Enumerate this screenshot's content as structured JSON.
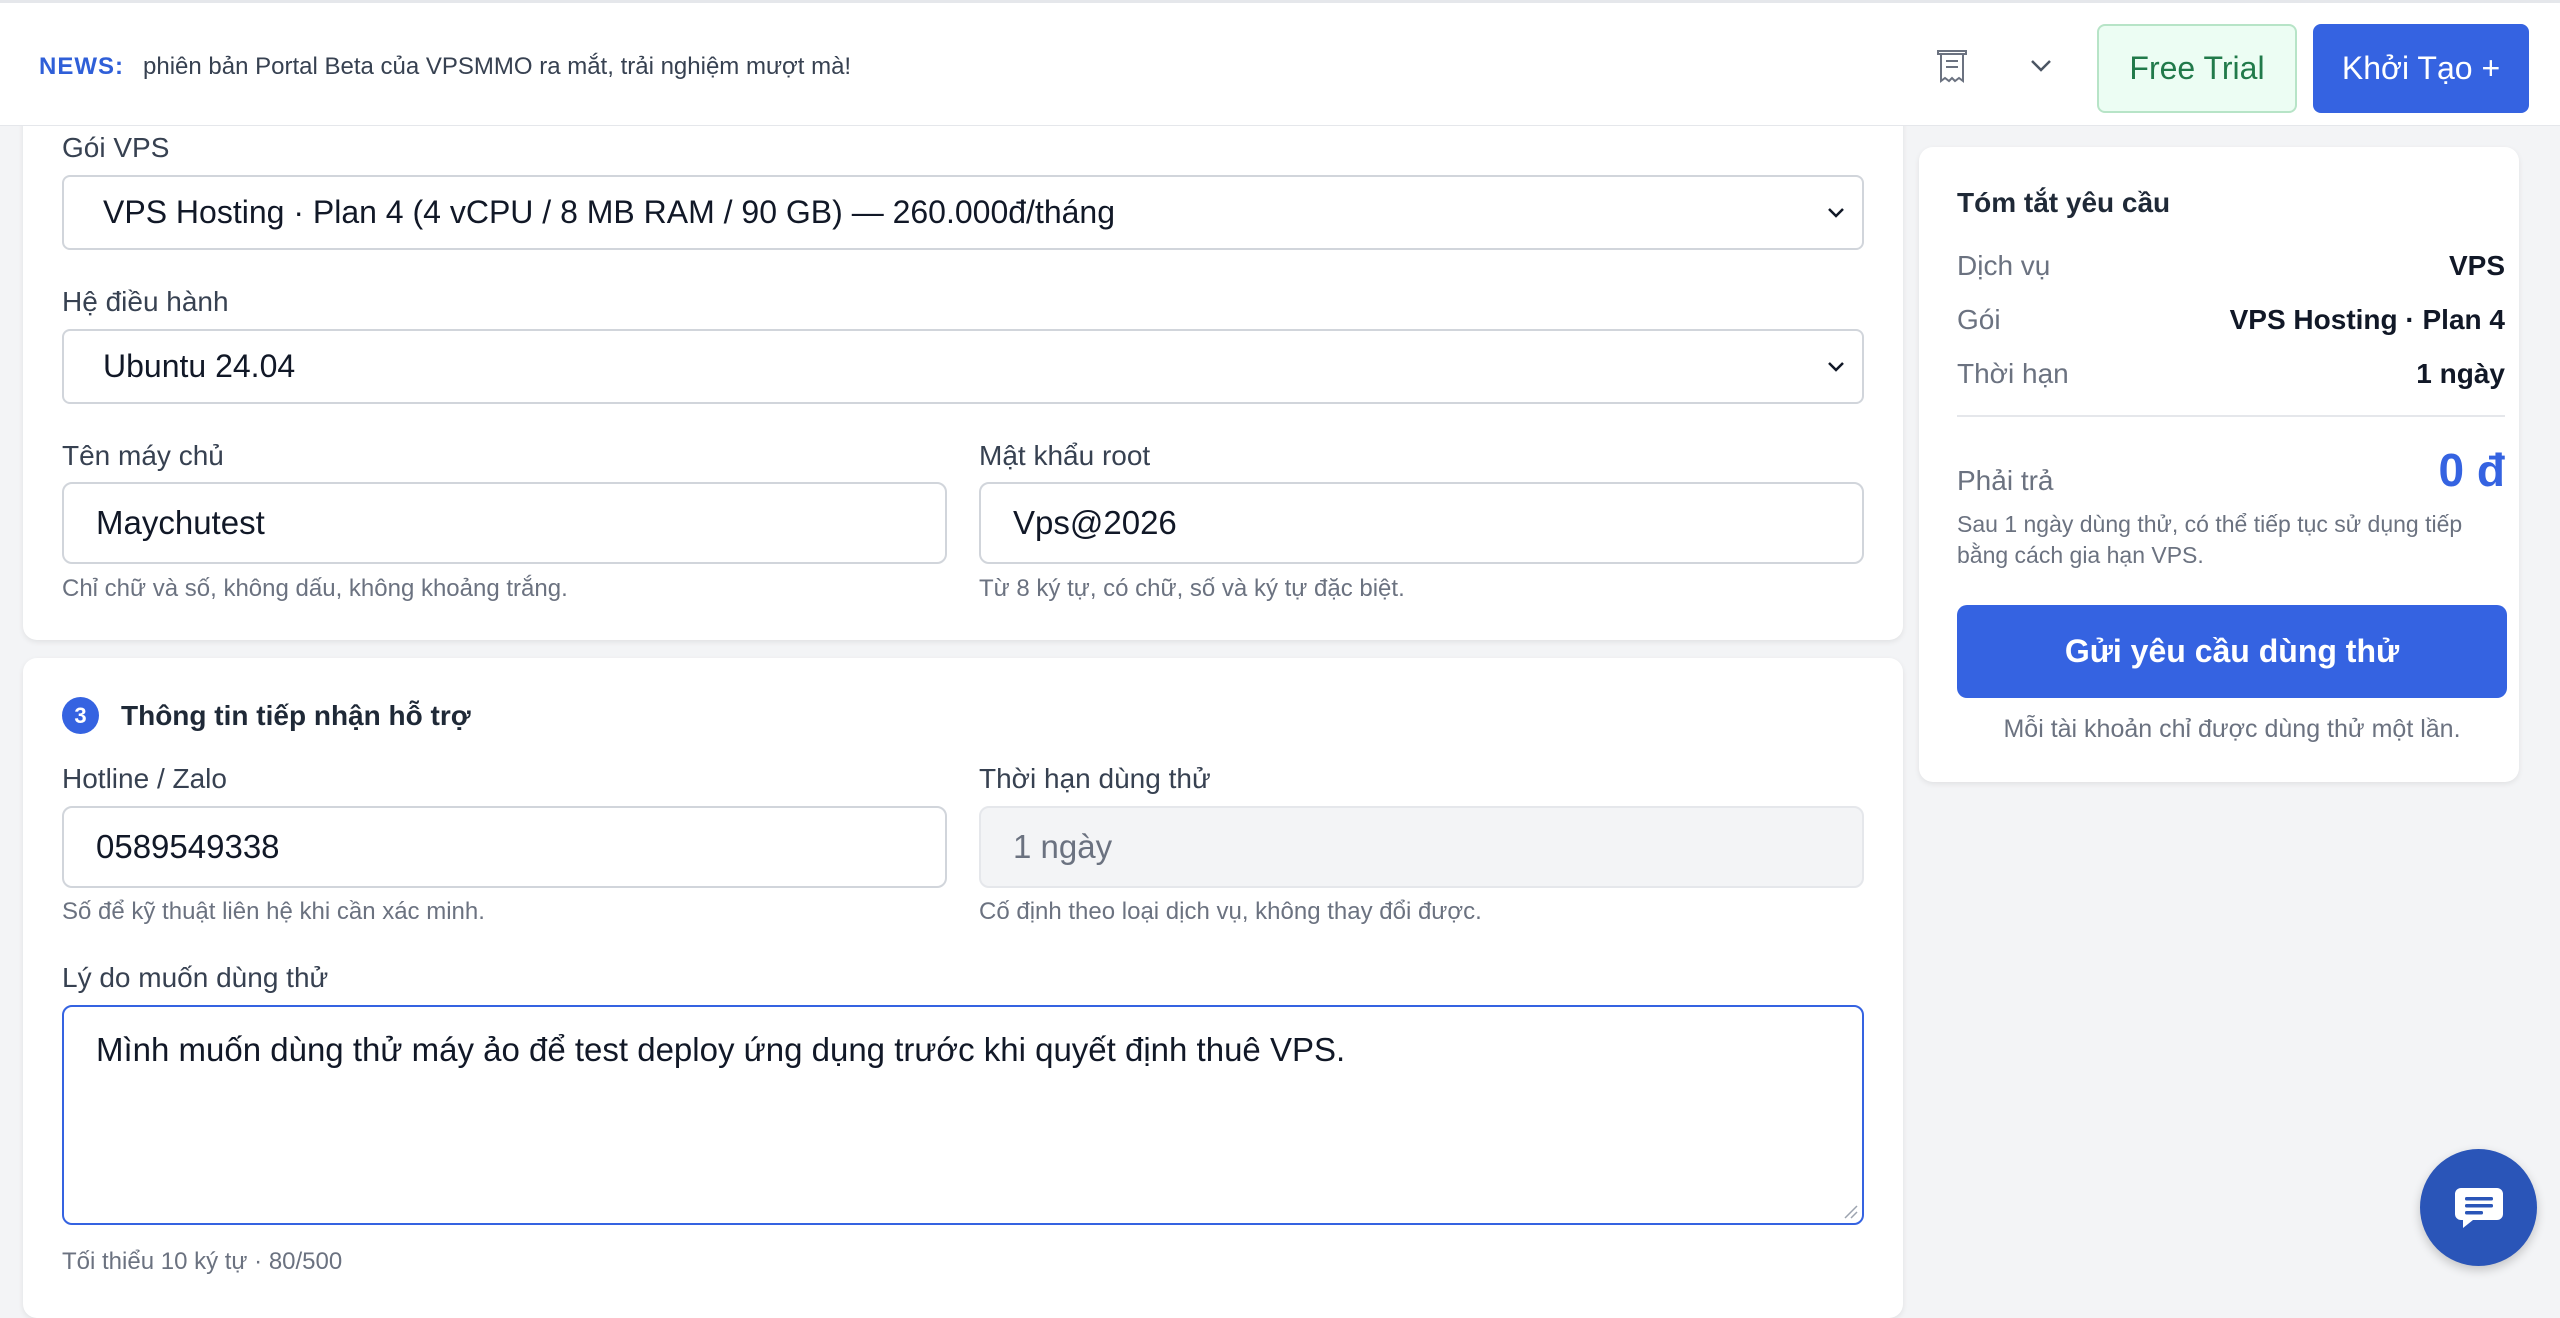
{
  "topbar": {
    "news_label": "NEWS:",
    "news_text": "phiên bản Portal Beta của VPSMMO ra mắt, trải nghiệm mượt mà!",
    "free_trial_label": "Free Trial",
    "create_label": "Khởi Tạo +"
  },
  "form": {
    "plan_label": "Gói VPS",
    "plan_value": "VPS Hosting · Plan 4 (4 vCPU / 8 MB RAM / 90 GB) — 260.000đ/tháng",
    "os_label": "Hệ điều hành",
    "os_value": "Ubuntu 24.04",
    "hostname_label": "Tên máy chủ",
    "hostname_value": "Maychutest",
    "hostname_hint": "Chỉ chữ và số, không dấu, không khoảng trắng.",
    "password_label": "Mật khẩu root",
    "password_value": "Vps@2026",
    "password_hint": "Từ 8 ký tự, có chữ, số và ký tự đặc biệt.",
    "section3_number": "3",
    "section3_title": "Thông tin tiếp nhận hỗ trợ",
    "hotline_label": "Hotline / Zalo",
    "hotline_value": "0589549338",
    "hotline_hint": "Số để kỹ thuật liên hệ khi cần xác minh.",
    "duration_label": "Thời hạn dùng thử",
    "duration_value": "1 ngày",
    "duration_hint": "Cố định theo loại dịch vụ, không thay đổi được.",
    "reason_label": "Lý do muốn dùng thử",
    "reason_value": "Mình muốn dùng thử máy ảo để test deploy ứng dụng trước khi quyết định thuê VPS.",
    "reason_hint": "Tối thiểu 10 ký tự · 80/500"
  },
  "summary": {
    "title": "Tóm tắt yêu cầu",
    "rows": [
      {
        "key": "Dịch vụ",
        "value": "VPS"
      },
      {
        "key": "Gói",
        "value": "VPS Hosting · Plan 4"
      },
      {
        "key": "Thời hạn",
        "value": "1 ngày"
      }
    ],
    "pay_label": "Phải trả",
    "pay_amount": "0 đ",
    "pay_note": "Sau 1 ngày dùng thử, có thể tiếp tục sử dụng tiếp bằng cách gia hạn VPS.",
    "submit_label": "Gửi yêu cầu dùng thử",
    "footer": "Mỗi tài khoản chỉ được dùng thử một lần."
  },
  "icons": {
    "receipt": "receipt-icon",
    "chevron": "chevron-down-icon",
    "chat": "chat-icon"
  },
  "colors": {
    "primary": "#3563e1",
    "trial_bg": "#ecfdf3",
    "trial_text": "#217a4a"
  }
}
